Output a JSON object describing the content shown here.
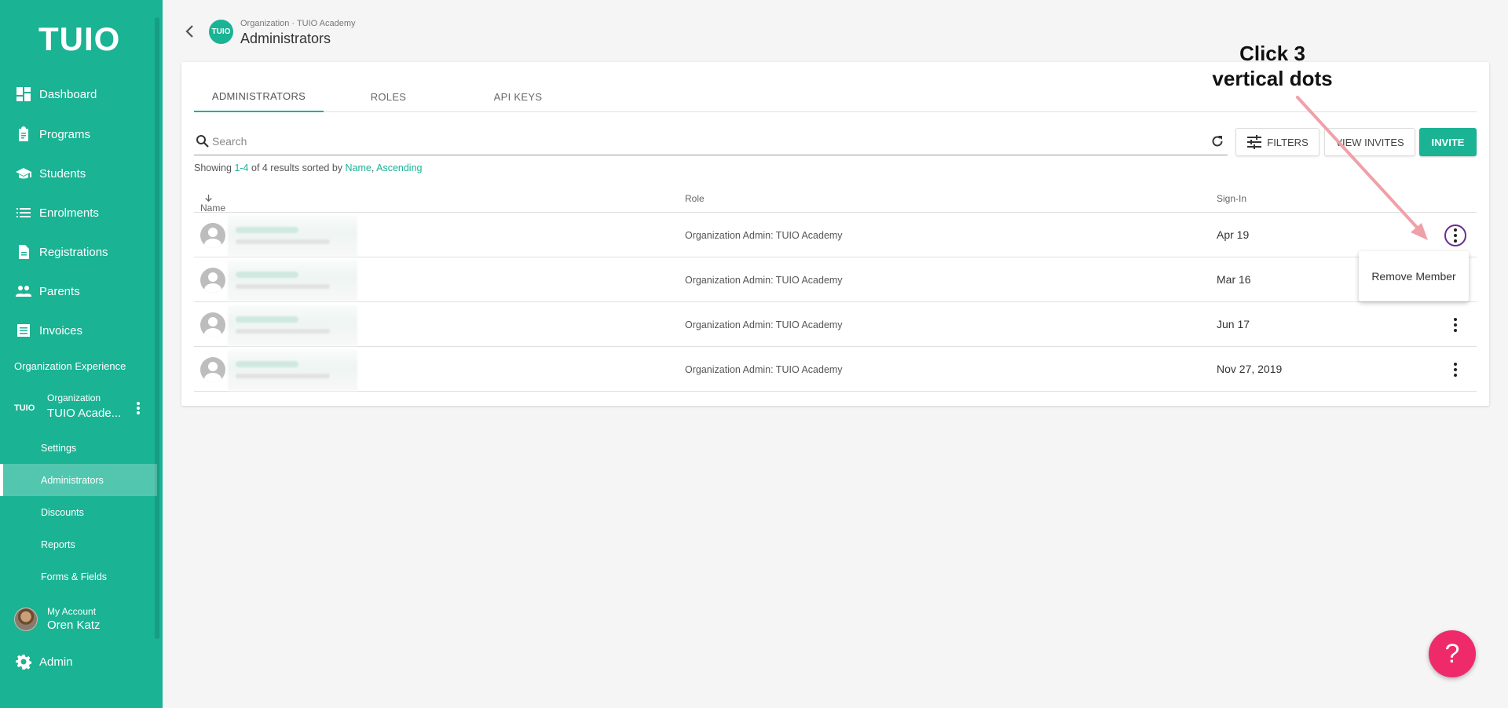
{
  "brand": {
    "logo_text": "TUIO",
    "accent": "#1ab394",
    "help_color": "#ee2a6b"
  },
  "sidebar": {
    "nav": [
      {
        "label": "Dashboard",
        "icon": "dashboard-icon"
      },
      {
        "label": "Programs",
        "icon": "clipboard-icon"
      },
      {
        "label": "Students",
        "icon": "graduation-cap-icon"
      },
      {
        "label": "Enrolments",
        "icon": "list-icon"
      },
      {
        "label": "Registrations",
        "icon": "document-icon"
      },
      {
        "label": "Parents",
        "icon": "people-icon"
      },
      {
        "label": "Invoices",
        "icon": "invoice-icon"
      }
    ],
    "section_label": "Organization Experience",
    "org": {
      "logo": "TUIO",
      "small": "Organization",
      "name": "TUIO Acade..."
    },
    "sub_items": [
      {
        "label": "Settings",
        "active": false
      },
      {
        "label": "Administrators",
        "active": true
      },
      {
        "label": "Discounts",
        "active": false
      },
      {
        "label": "Reports",
        "active": false
      },
      {
        "label": "Forms & Fields",
        "active": false
      }
    ],
    "account": {
      "small": "My Account",
      "name": "Oren Katz"
    },
    "admin_label": "Admin"
  },
  "header": {
    "logo": "TUIO",
    "breadcrumb": "Organization · TUIO Academy",
    "title": "Administrators"
  },
  "tabs": [
    {
      "label": "ADMINISTRATORS",
      "active": true
    },
    {
      "label": "ROLES",
      "active": false
    },
    {
      "label": "API KEYS",
      "active": false
    }
  ],
  "toolbar": {
    "search_placeholder": "Search",
    "filters_label": "FILTERS",
    "view_invites_label": "VIEW INVITES",
    "invite_label": "INVITE"
  },
  "results": {
    "prefix": "Showing ",
    "range": "1-4",
    "middle": " of 4 results sorted by ",
    "sort_field": "Name",
    "sep": ", ",
    "sort_dir": "Ascending"
  },
  "table": {
    "columns": [
      "Name",
      "Role",
      "Sign-In"
    ],
    "rows": [
      {
        "role": "Organization Admin: TUIO Academy",
        "signin": "Apr 19"
      },
      {
        "role": "Organization Admin: TUIO Academy",
        "signin": "Mar 16"
      },
      {
        "role": "Organization Admin: TUIO Academy",
        "signin": "Jun 17"
      },
      {
        "role": "Organization Admin: TUIO Academy",
        "signin": "Nov 27, 2019"
      }
    ]
  },
  "context_menu": {
    "item": "Remove Member"
  },
  "callout": {
    "line1": "Click 3",
    "line2": "vertical dots"
  },
  "help_label": "?"
}
